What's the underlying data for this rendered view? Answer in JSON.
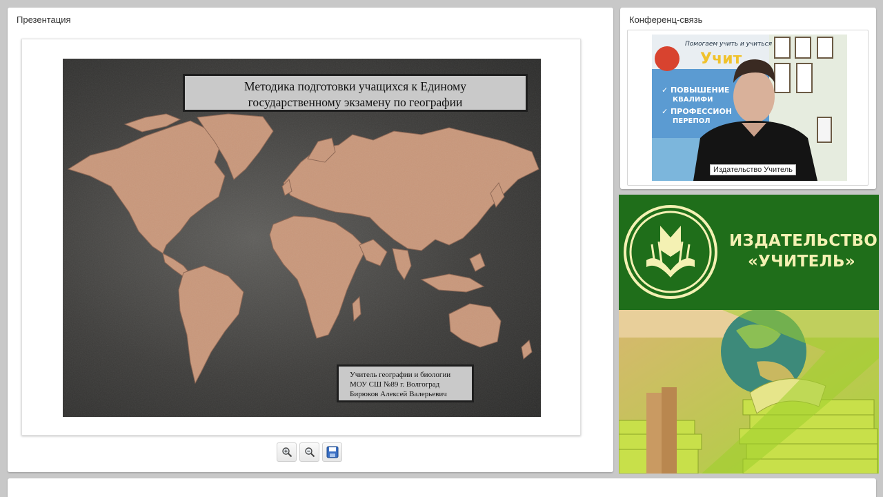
{
  "presentation_panel": {
    "title": "Презентация",
    "slide": {
      "title_line1": "Методика подготовки учащихся к Единому",
      "title_line2": "государственному экзамену по географии",
      "author_line1": "Учитель географии и биологии",
      "author_line2": "МОУ СШ №89 г. Волгоград",
      "author_line3": "Бирюков Алексей Валерьевич"
    },
    "toolbar": {
      "zoom_in_icon": "zoom-in-icon",
      "zoom_out_icon": "zoom-out-icon",
      "save_icon": "save-icon"
    }
  },
  "conference_panel": {
    "title": "Конференц-связь",
    "video_label": "Издательство Учитель"
  },
  "publisher": {
    "name_line1": "ИЗДАТЕЛЬСТВО",
    "name_line2": "«УЧИТЕЛЬ»"
  },
  "colors": {
    "publisher_green": "#1f6e1a",
    "publisher_text": "#f4f1b3",
    "continent": "#c9977a",
    "slide_background": "#4a4947"
  }
}
